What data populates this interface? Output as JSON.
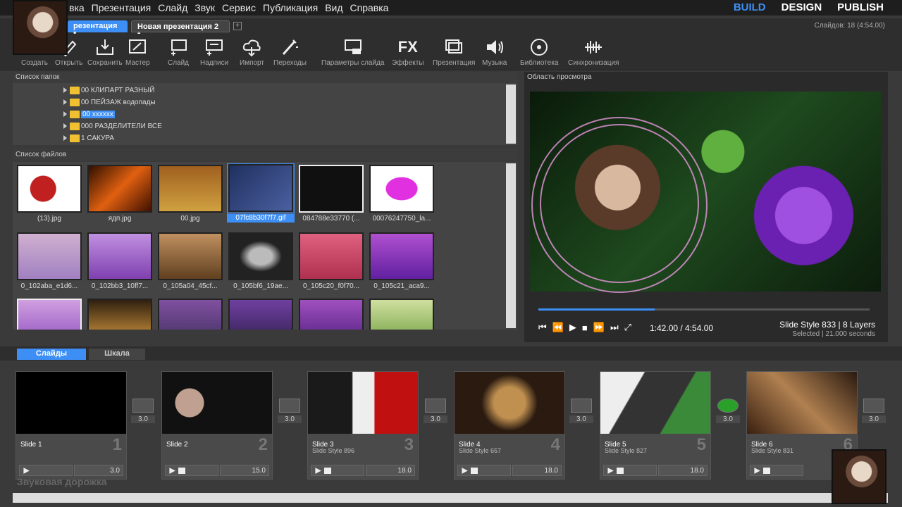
{
  "menu": {
    "items": [
      "вка",
      "Презентация",
      "Слайд",
      "Звук",
      "Сервис",
      "Публикация",
      "Вид",
      "Справка"
    ],
    "modes": [
      "BUILD",
      "DESIGN",
      "PUBLISH"
    ]
  },
  "doc_tabs": {
    "tab1": "резентация *",
    "tab2": "Новая презентация 2 *",
    "add": "+",
    "slide_count": "Слайдов: 18 (4:54.00)"
  },
  "toolbar": {
    "create": "Создать",
    "open": "Открыть",
    "save": "Сохранить",
    "wizard": "Мастер",
    "slide": "Слайд",
    "captions": "Надписи",
    "import": "Импорт",
    "transitions": "Переходы",
    "slide_params": "Параметры слайда",
    "effects": "Эффекты",
    "presentation": "Презентация",
    "music": "Музыка",
    "library": "Библиотека",
    "sync": "Синхронизация",
    "fx_glyph": "FX"
  },
  "folders": {
    "title": "Список папок",
    "items": [
      "00 КЛИПАРТ РАЗНЫЙ",
      "00 ПЕЙЗАЖ водопады",
      "00 хххххх",
      "000 РАЗДЕЛИТЕЛИ ВСЕ",
      "1 САКУРА"
    ]
  },
  "files": {
    "title": "Список файлов",
    "items": [
      "(13).jpg",
      "ядп.jpg",
      "00.jpg",
      "07fc8b30f7f7.gif",
      "084788e33770 (...",
      "00076247750_la...",
      "0_102aba_e1d6...",
      "0_102bb3_10ff7...",
      "0_105a04_45cf...",
      "0_105bf6_19ae...",
      "0_105c20_f0f70...",
      "0_105c21_aca9...",
      "",
      "",
      "",
      "",
      "",
      ""
    ]
  },
  "preview": {
    "title": "Область просмотра",
    "time": "1:42.00 / 4:54.00",
    "progress": 0.35,
    "slide_info": "Slide Style 833  |  8 Layers",
    "slide_info2": "Selected  |  21.000 seconds"
  },
  "bottom_tabs": {
    "slides": "Слайды",
    "timeline": "Шкала"
  },
  "slides": [
    {
      "title": "Slide 1",
      "style": "",
      "num": "1",
      "duration": "3.0"
    },
    {
      "title": "Slide 2",
      "style": "",
      "num": "2",
      "duration": "15.0"
    },
    {
      "title": "Slide 3",
      "style": "Slide Style 896",
      "num": "3",
      "duration": "18.0"
    },
    {
      "title": "Slide 4",
      "style": "Slide Style 657",
      "num": "4",
      "duration": "18.0"
    },
    {
      "title": "Slide 5",
      "style": "Slide Style 827",
      "num": "5",
      "duration": "18.0"
    },
    {
      "title": "Slide 6",
      "style": "Slide Style 831",
      "num": "6",
      "duration": ""
    }
  ],
  "transitions": [
    "3.0",
    "3.0",
    "3.0",
    "3.0",
    "3.0",
    "3.0"
  ],
  "hint": "Звуковая дорожка",
  "colors": {
    "accent": "#3d8ff5",
    "folder": "#f0c030"
  }
}
